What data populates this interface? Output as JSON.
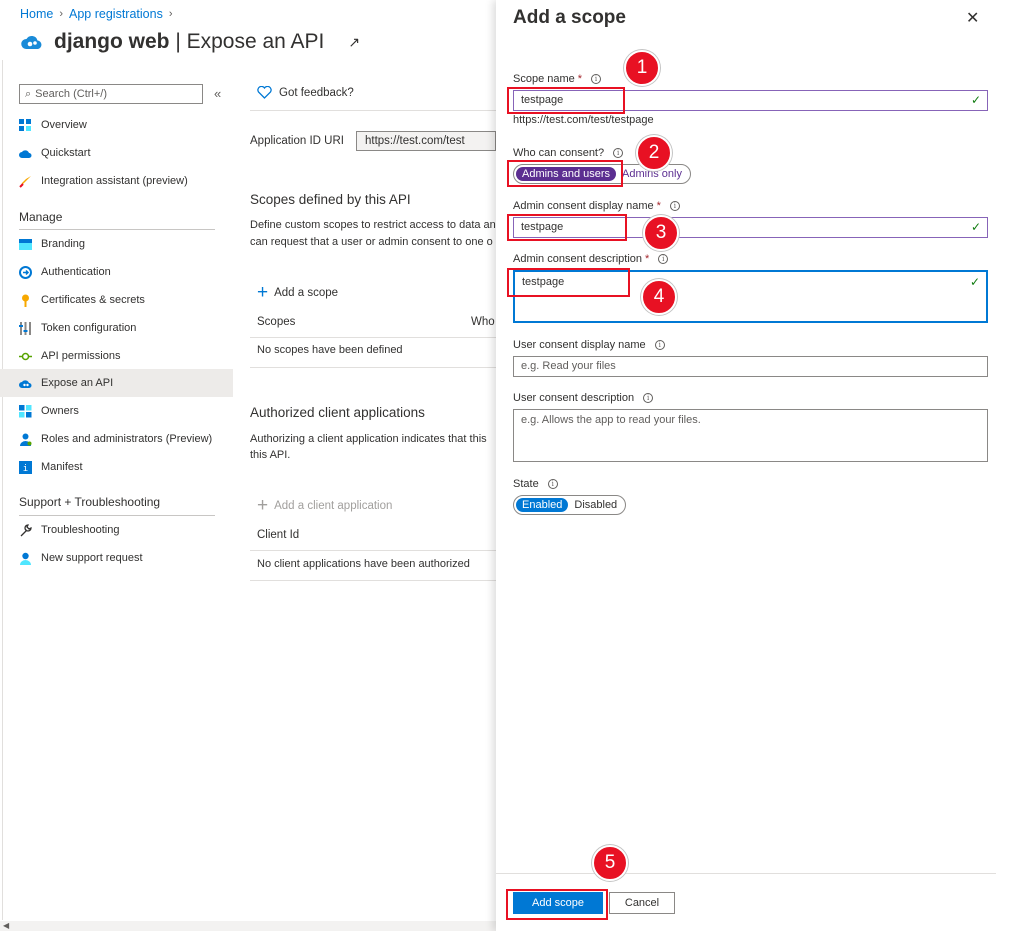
{
  "breadcrumb": {
    "home": "Home",
    "app_registrations": "App registrations"
  },
  "title": {
    "app_name": "django web",
    "separator": " | ",
    "page": "Expose an API"
  },
  "sidebar": {
    "search_placeholder": "Search (Ctrl+/)",
    "collapse": "«",
    "top_items": [
      {
        "label": "Overview",
        "icon": "overview-icon"
      },
      {
        "label": "Quickstart",
        "icon": "quickstart-icon"
      },
      {
        "label": "Integration assistant (preview)",
        "icon": "rocket-icon"
      }
    ],
    "manage_heading": "Manage",
    "manage_items": [
      {
        "label": "Branding",
        "icon": "branding-icon"
      },
      {
        "label": "Authentication",
        "icon": "authentication-icon"
      },
      {
        "label": "Certificates & secrets",
        "icon": "key-icon"
      },
      {
        "label": "Token configuration",
        "icon": "token-config-icon"
      },
      {
        "label": "API permissions",
        "icon": "api-permissions-icon"
      },
      {
        "label": "Expose an API",
        "icon": "cloud-icon",
        "active": true
      },
      {
        "label": "Owners",
        "icon": "owners-icon"
      },
      {
        "label": "Roles and administrators (Preview)",
        "icon": "roles-icon"
      },
      {
        "label": "Manifest",
        "icon": "manifest-icon"
      }
    ],
    "support_heading": "Support + Troubleshooting",
    "support_items": [
      {
        "label": "Troubleshooting",
        "icon": "wrench-icon"
      },
      {
        "label": "New support request",
        "icon": "support-person-icon"
      }
    ]
  },
  "main": {
    "feedback": "Got feedback?",
    "app_id_uri_label": "Application ID URI",
    "app_id_uri_value": "https://test.com/test",
    "scopes_heading": "Scopes defined by this API",
    "scopes_desc_line1": "Define custom scopes to restrict access to data an",
    "scopes_desc_line2": "can request that a user or admin consent to one o",
    "add_scope": "Add a scope",
    "scopes_col1": "Scopes",
    "scopes_col2": "Who",
    "scopes_empty": "No scopes have been defined",
    "clients_heading": "Authorized client applications",
    "clients_desc_line1": "Authorizing a client application indicates that this",
    "clients_desc_line2": "this API.",
    "add_client": "Add a client application",
    "clients_col1": "Client Id",
    "clients_empty": "No client applications have been authorized"
  },
  "panel": {
    "title": "Add a scope",
    "close": "✕",
    "scope_name_label": "Scope name",
    "scope_name_value": "testpage",
    "scope_name_full": "https://test.com/test/testpage",
    "who_consent_label": "Who can consent?",
    "consent_options": [
      "Admins and users",
      "Admins only"
    ],
    "consent_selected": "Admins and users",
    "admin_display_label": "Admin consent display name",
    "admin_display_value": "testpage",
    "admin_desc_label": "Admin consent description",
    "admin_desc_value": "testpage",
    "user_display_label": "User consent display name",
    "user_display_placeholder": "e.g. Read your files",
    "user_desc_label": "User consent description",
    "user_desc_placeholder": "e.g. Allows the app to read your files.",
    "state_label": "State",
    "state_options": [
      "Enabled",
      "Disabled"
    ],
    "state_selected": "Enabled",
    "add_button": "Add scope",
    "cancel_button": "Cancel",
    "required_mark": "*"
  },
  "annotations": [
    "1",
    "2",
    "3",
    "4",
    "5"
  ],
  "colors": {
    "accent": "#0078d4",
    "purple": "#5c2e91",
    "annotation_red": "#e81123",
    "valid_check": "#107c10"
  }
}
